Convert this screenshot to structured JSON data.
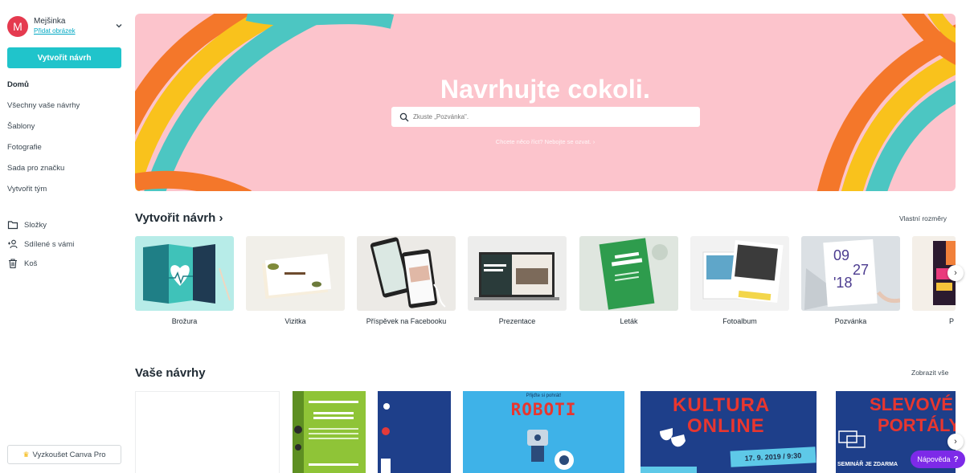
{
  "account": {
    "initial": "M",
    "name": "Mejšinka",
    "add_photo": "Přidat obrázek"
  },
  "sidebar": {
    "create_button": "Vytvořit návrh",
    "nav": [
      {
        "label": "Domů"
      },
      {
        "label": "Všechny vaše návrhy"
      },
      {
        "label": "Šablony"
      },
      {
        "label": "Fotografie"
      },
      {
        "label": "Sada pro značku"
      },
      {
        "label": "Vytvořit tým"
      }
    ],
    "nav2": [
      {
        "label": "Složky",
        "icon": "folder-icon"
      },
      {
        "label": "Sdílené s vámi",
        "icon": "shared-users-icon"
      },
      {
        "label": "Koš",
        "icon": "trash-icon"
      }
    ],
    "try_pro": "Vyzkoušet Canva Pro"
  },
  "hero": {
    "title": "Navrhujte cokoli.",
    "search_placeholder": "Zkuste „Pozvánka\".",
    "help_text": "Chcete něco říct? Nebojte se ozvat. ›"
  },
  "create_section": {
    "title": "Vytvořit návrh ›",
    "custom_size": "Vlastní rozměry",
    "templates": [
      {
        "label": "Brožura"
      },
      {
        "label": "Vizitka"
      },
      {
        "label": "Příspěvek na Facebooku"
      },
      {
        "label": "Prezentace"
      },
      {
        "label": "Leták"
      },
      {
        "label": "Fotoalbum"
      },
      {
        "label": "Pozvánka"
      },
      {
        "label": "P"
      }
    ]
  },
  "designs_section": {
    "title": "Vaše návrhy",
    "show_all": "Zobrazit vše",
    "robot_top": "Přijďte si pohrát!",
    "robot_title": "ROBOTI",
    "kultura_title_1": "KULTURA",
    "kultura_title_2": "ONLINE",
    "kultura_date": "17. 9. 2019 / 9:30",
    "slevove_title_1": "SLEVOVÉ",
    "slevove_title_2": "PORTÁLY",
    "slevove_sub": "SEMINÁŘ JE ZDARMA"
  },
  "help_button": {
    "label": "Nápověda",
    "mark": "?"
  },
  "colors": {
    "accent": "#20c4cb",
    "hero_bg": "#fcc4cc",
    "avatar": "#e53a4f",
    "help": "#7d2ae8"
  }
}
